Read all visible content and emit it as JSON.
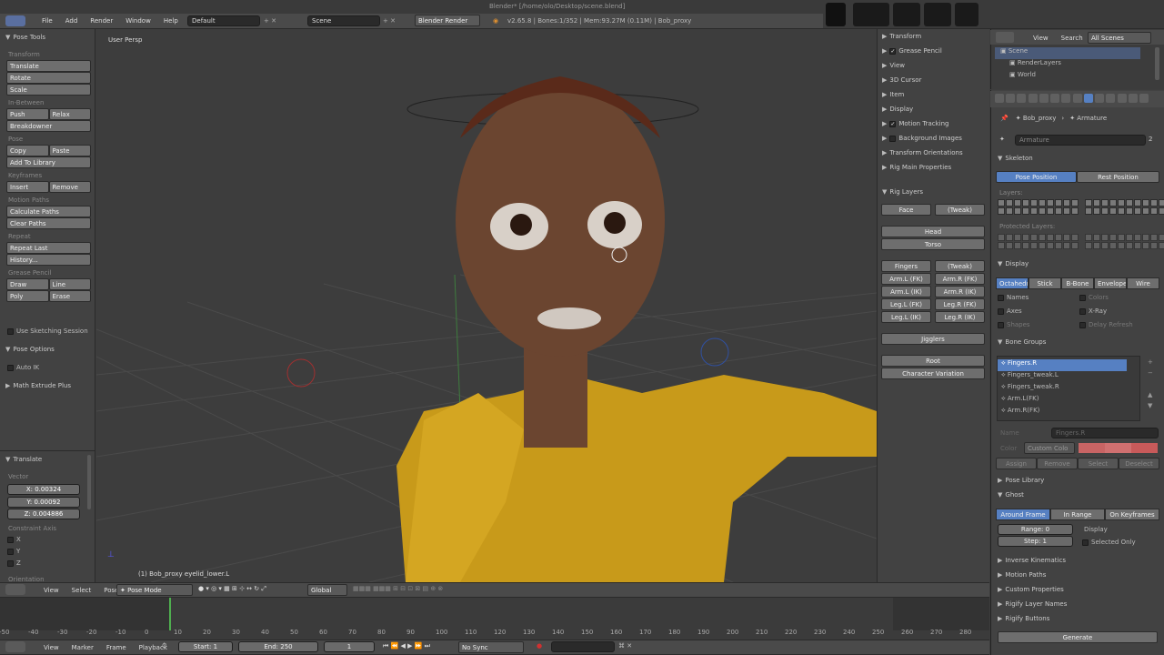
{
  "window": {
    "title": "Blender* [/home/olo/Desktop/scene.blend]"
  },
  "topbar": {
    "menus": [
      "File",
      "Add",
      "Render",
      "Window",
      "Help"
    ],
    "layout": "Default",
    "scene": "Scene",
    "engine": "Blender Render",
    "stats": "v2.65.8 | Bones:1/352 | Mem:93.27M (0.11M) | Bob_proxy"
  },
  "viewport": {
    "label": "User Persp",
    "status": "(1) Bob_proxy eyelid_lower.L"
  },
  "tool": {
    "title": "Pose Tools",
    "sections": [
      {
        "label": "Transform",
        "buttons": [
          [
            "Translate"
          ],
          [
            "Rotate"
          ],
          [
            "Scale"
          ]
        ]
      },
      {
        "label": "In-Between",
        "buttons": [
          [
            "Push",
            "Relax"
          ],
          [
            "Breakdowner"
          ]
        ]
      },
      {
        "label": "Pose",
        "buttons": [
          [
            "Copy",
            "Paste"
          ],
          [
            "Add To Library"
          ]
        ]
      },
      {
        "label": "Keyframes",
        "buttons": [
          [
            "Insert",
            "Remove"
          ]
        ]
      },
      {
        "label": "Motion Paths",
        "buttons": [
          [
            "Calculate Paths"
          ],
          [
            "Clear Paths"
          ]
        ]
      },
      {
        "label": "Repeat",
        "buttons": [
          [
            "Repeat Last"
          ],
          [
            "History..."
          ]
        ]
      },
      {
        "label": "Grease Pencil",
        "buttons": [
          [
            "Draw",
            "Line"
          ],
          [
            "Poly",
            "Erase"
          ]
        ]
      }
    ],
    "sketch": "Use Sketching Session",
    "pose_options": "Pose Options",
    "auto_ik": "Auto IK",
    "math_extrude": "Math Extrude Plus"
  },
  "operator": {
    "title": "Translate",
    "vector_label": "Vector",
    "x": "X: 0.00324",
    "y": "Y: 0.00092",
    "z": "Z: 0.004886",
    "constraint": "Constraint Axis",
    "axes": [
      "X",
      "Y",
      "Z"
    ],
    "orientation": "Orientation"
  },
  "props": {
    "items": [
      {
        "t": "Transform"
      },
      {
        "t": "Grease Pencil",
        "cb": true
      },
      {
        "t": "View"
      },
      {
        "t": "3D Cursor"
      },
      {
        "t": "Item"
      },
      {
        "t": "Display"
      },
      {
        "t": "Motion Tracking",
        "cb": true
      },
      {
        "t": "Background Images",
        "cb": false
      },
      {
        "t": "Transform Orientations"
      },
      {
        "t": "Rig Main Properties"
      }
    ],
    "rig_layers": "Rig Layers",
    "rig_rows": [
      [
        "Face",
        "(Tweak)"
      ],
      [
        "Head"
      ],
      [
        "Torso"
      ],
      [
        "Fingers",
        "(Tweak)"
      ],
      [
        "Arm.L (FK)",
        "Arm.R (FK)"
      ],
      [
        "Arm.L (IK)",
        "Arm.R (IK)"
      ],
      [
        "Leg.L (FK)",
        "Leg.R (FK)"
      ],
      [
        "Leg.L (IK)",
        "Leg.R (IK)"
      ],
      [
        "Jigglers"
      ],
      [
        "Root"
      ],
      [
        "Character Variation"
      ]
    ]
  },
  "outliner": {
    "menus": [
      "View",
      "Search"
    ],
    "filter": "All Scenes",
    "tree": [
      "Scene",
      "RenderLayers",
      "World"
    ]
  },
  "properties": {
    "breadcrumb": [
      "Bob_proxy",
      "Armature"
    ],
    "datablock": "Armature",
    "datablock_users": "2",
    "skeleton": {
      "title": "Skeleton",
      "pose_position": "Pose Position",
      "rest_position": "Rest Position",
      "layers": "Layers:",
      "protected": "Protected Layers:"
    },
    "display": {
      "title": "Display",
      "tabs": [
        "Octahedral",
        "Stick",
        "B-Bone",
        "Envelope",
        "Wire"
      ],
      "opts": [
        [
          "Names",
          "Colors"
        ],
        [
          "Axes",
          "X-Ray"
        ],
        [
          "Shapes",
          "Delay Refresh"
        ]
      ]
    },
    "bone_groups": {
      "title": "Bone Groups",
      "items": [
        "Fingers.R",
        "Fingers_tweak.L",
        "Fingers_tweak.R",
        "Arm.L(FK)",
        "Arm.R(FK)"
      ],
      "name_label": "Name",
      "name_value": "Fingers.R",
      "color_label": "Color",
      "color_value": "Custom Colo",
      "buttons": [
        "Assign",
        "Remove",
        "Select",
        "Deselect"
      ],
      "swatches": [
        "#c86464",
        "#d07070",
        "#c85a5a"
      ]
    },
    "pose_library": "Pose Library",
    "ghost": {
      "title": "Ghost",
      "tabs": [
        "Around Frame",
        "In Range",
        "On Keyframes"
      ],
      "range": "Range: 0",
      "step": "Step: 1",
      "display": "Display",
      "selected_only": "Selected Only"
    },
    "more": [
      "Inverse Kinematics",
      "Motion Paths",
      "Custom Properties",
      "Rigify Layer Names",
      "Rigify Buttons"
    ],
    "generate": "Generate"
  },
  "header3d": {
    "menus": [
      "View",
      "Select",
      "Pose"
    ],
    "mode": "Pose Mode",
    "orientation": "Global"
  },
  "timeline": {
    "ticks": [
      "-50",
      "-40",
      "-30",
      "-20",
      "-10",
      "0",
      "10",
      "20",
      "30",
      "40",
      "50",
      "60",
      "70",
      "80",
      "90",
      "100",
      "110",
      "120",
      "130",
      "140",
      "150",
      "160",
      "170",
      "180",
      "190",
      "200",
      "210",
      "220",
      "230",
      "240",
      "250",
      "260",
      "270",
      "280"
    ],
    "menus": [
      "View",
      "Marker",
      "Frame",
      "Playback"
    ],
    "start": "Start: 1",
    "end": "End: 250",
    "current": "1",
    "sync": "No Sync"
  },
  "colors": {
    "accent": "#5680c2",
    "shirt": "#d4a020",
    "skin": "#6b4530",
    "hair": "#5a2a1a"
  }
}
